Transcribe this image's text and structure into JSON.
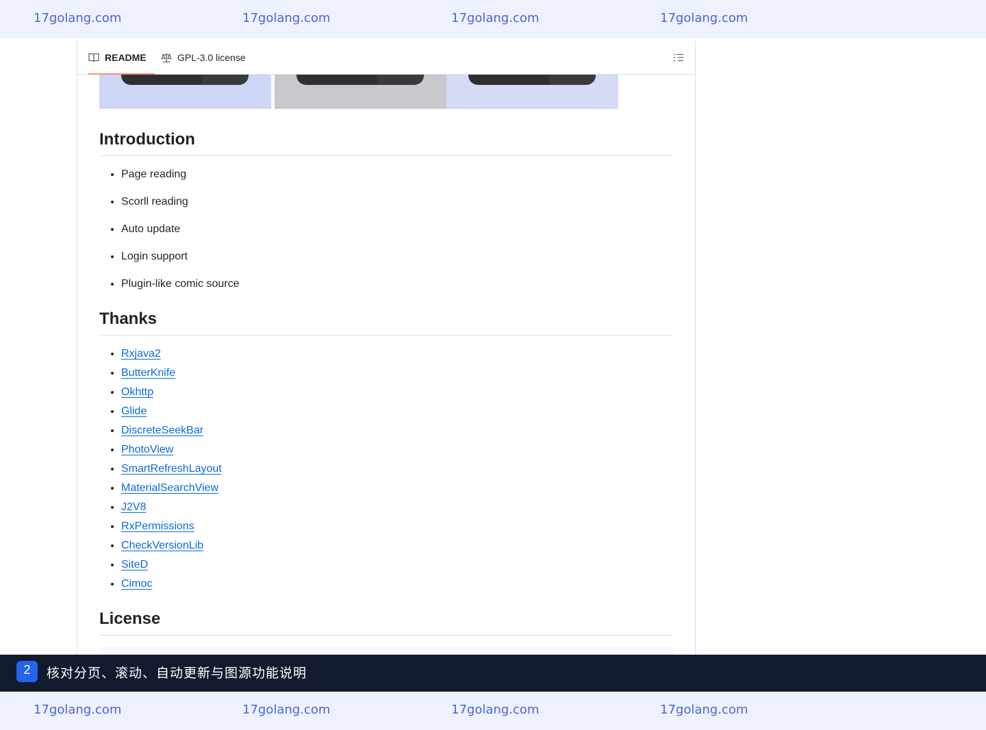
{
  "watermark": {
    "top": [
      "17golang.com",
      "17golang.com",
      "17golang.com",
      "17golang.com"
    ],
    "bottom": [
      "17golang.com",
      "17golang.com",
      "17golang.com",
      "17golang.com"
    ]
  },
  "tabs": {
    "readme": "README",
    "license": "GPL-3.0 license"
  },
  "screenshot_colors": [
    "#cdd6f4",
    "#c8c9cd",
    "#d5daf5"
  ],
  "sections": {
    "introduction": {
      "title": "Introduction",
      "items": [
        "Page reading",
        "Scorll reading",
        "Auto update",
        "Login support",
        "Plugin-like comic source"
      ]
    },
    "thanks": {
      "title": "Thanks",
      "links": [
        "Rxjava2",
        "ButterKnife",
        "Okhttp",
        "Glide",
        "DiscreteSeekBar",
        "PhotoView",
        "SmartRefreshLayout",
        "MaterialSearchView",
        "J2V8",
        "RxPermissions",
        "CheckVersionLib",
        "SiteD",
        "Cimoc"
      ]
    },
    "license": {
      "title": "License"
    }
  },
  "caption": {
    "step": "2",
    "text": "核对分页、滚动、自动更新与图源功能说明"
  },
  "colors": {
    "link": "#0969da",
    "tab_underline": "#fd8c73",
    "caption_bg": "#121a2e",
    "badge": "#2563eb",
    "watermark_bg": "#eef2ff"
  }
}
